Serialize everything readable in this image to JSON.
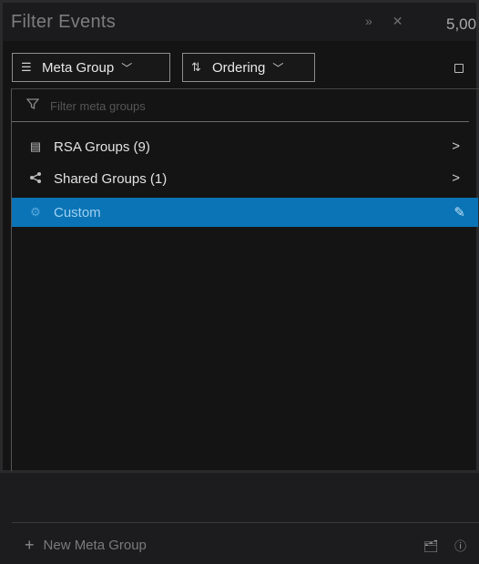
{
  "panel": {
    "title": "Filter Events",
    "title_icons": [
      "»",
      "✕"
    ],
    "value_peek": "5,00"
  },
  "toolbar": {
    "meta_group_label": "Meta Group",
    "ordering_label": "Ordering"
  },
  "filter": {
    "placeholder": "Filter meta groups"
  },
  "groups": [
    {
      "label": "RSA Groups (9)",
      "icon": "layers-icon",
      "arrow": ">"
    },
    {
      "label": "Shared Groups (1)",
      "icon": "share-icon",
      "arrow": ">"
    },
    {
      "label": "Custom",
      "icon": "gear-icon",
      "arrow": "✎",
      "selected": true
    }
  ],
  "footer": {
    "new_group_label": "New Meta Group"
  },
  "colors": {
    "selection": "#0b74b6",
    "panel_bg": "#141414"
  }
}
